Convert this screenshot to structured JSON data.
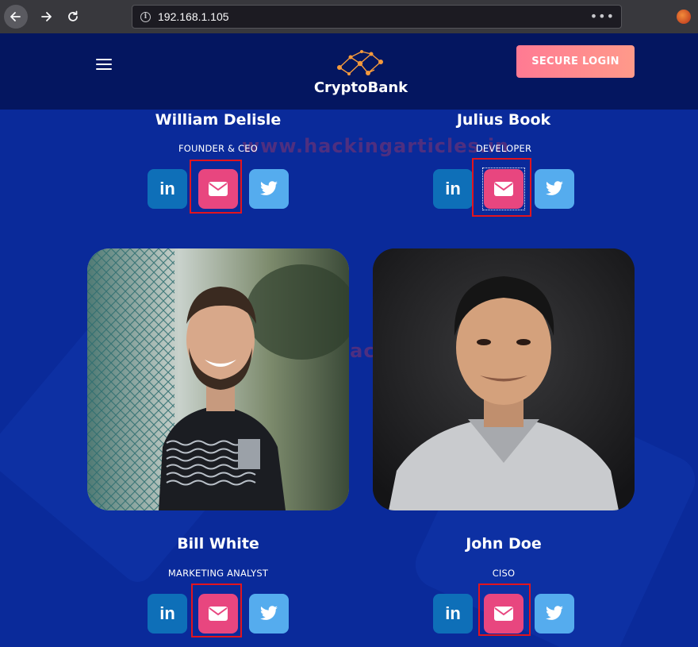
{
  "browser": {
    "url": "192.168.1.105"
  },
  "header": {
    "logo_text": "CryptoBank",
    "login_label": "SECURE LOGIN"
  },
  "watermark": "www.hackingarticles.in",
  "team": [
    {
      "name": "William Delisle",
      "role": "FOUNDER & CEO"
    },
    {
      "name": "Julius Book",
      "role": "DEVELOPER"
    },
    {
      "name": "Bill White",
      "role": "MARKETING ANALYST"
    },
    {
      "name": "John Doe",
      "role": "CISO"
    }
  ],
  "social_icons": {
    "linkedin_text": "in"
  },
  "colors": {
    "page_bg": "#0a2a9a",
    "header_bg": "#041660",
    "login_gradient_start": "#ff7a93",
    "login_gradient_end": "#ff9a8a",
    "linkedin": "#0e6fb8",
    "mail": "#e8467f",
    "twitter": "#55acee",
    "highlight": "#e3141d"
  }
}
